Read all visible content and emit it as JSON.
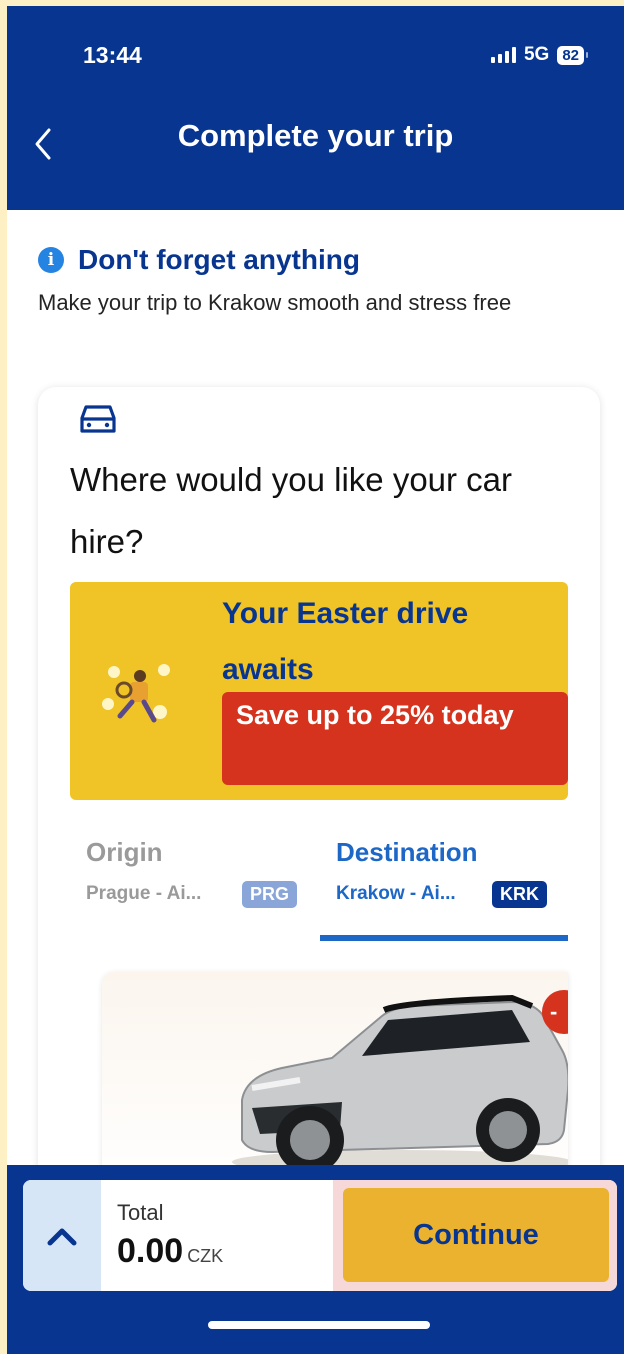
{
  "status_bar": {
    "time": "13:44",
    "network": "5G",
    "battery": "82"
  },
  "header": {
    "title": "Complete your trip"
  },
  "info": {
    "title": "Don't forget anything",
    "subtitle": "Make your trip to Krakow smooth and stress free"
  },
  "car_hire": {
    "question": "Where would you like your car hire?",
    "promo": {
      "title": "Your Easter drive awaits",
      "badge": "Save up to 25% today"
    },
    "tabs": {
      "origin": {
        "label": "Origin",
        "place": "Prague - Ai...",
        "code": "PRG"
      },
      "destination": {
        "label": "Destination",
        "place": "Krakow - Ai...",
        "code": "KRK",
        "selected": true
      }
    },
    "offer_badge": "-"
  },
  "footer": {
    "total_label": "Total",
    "total_amount": "0.00",
    "currency": "CZK",
    "continue_label": "Continue"
  },
  "colors": {
    "brand_blue": "#073590",
    "accent_yellow": "#f0c326",
    "cta_yellow": "#ebb22f",
    "sale_red": "#d5331d",
    "link_blue": "#1d67c7"
  }
}
